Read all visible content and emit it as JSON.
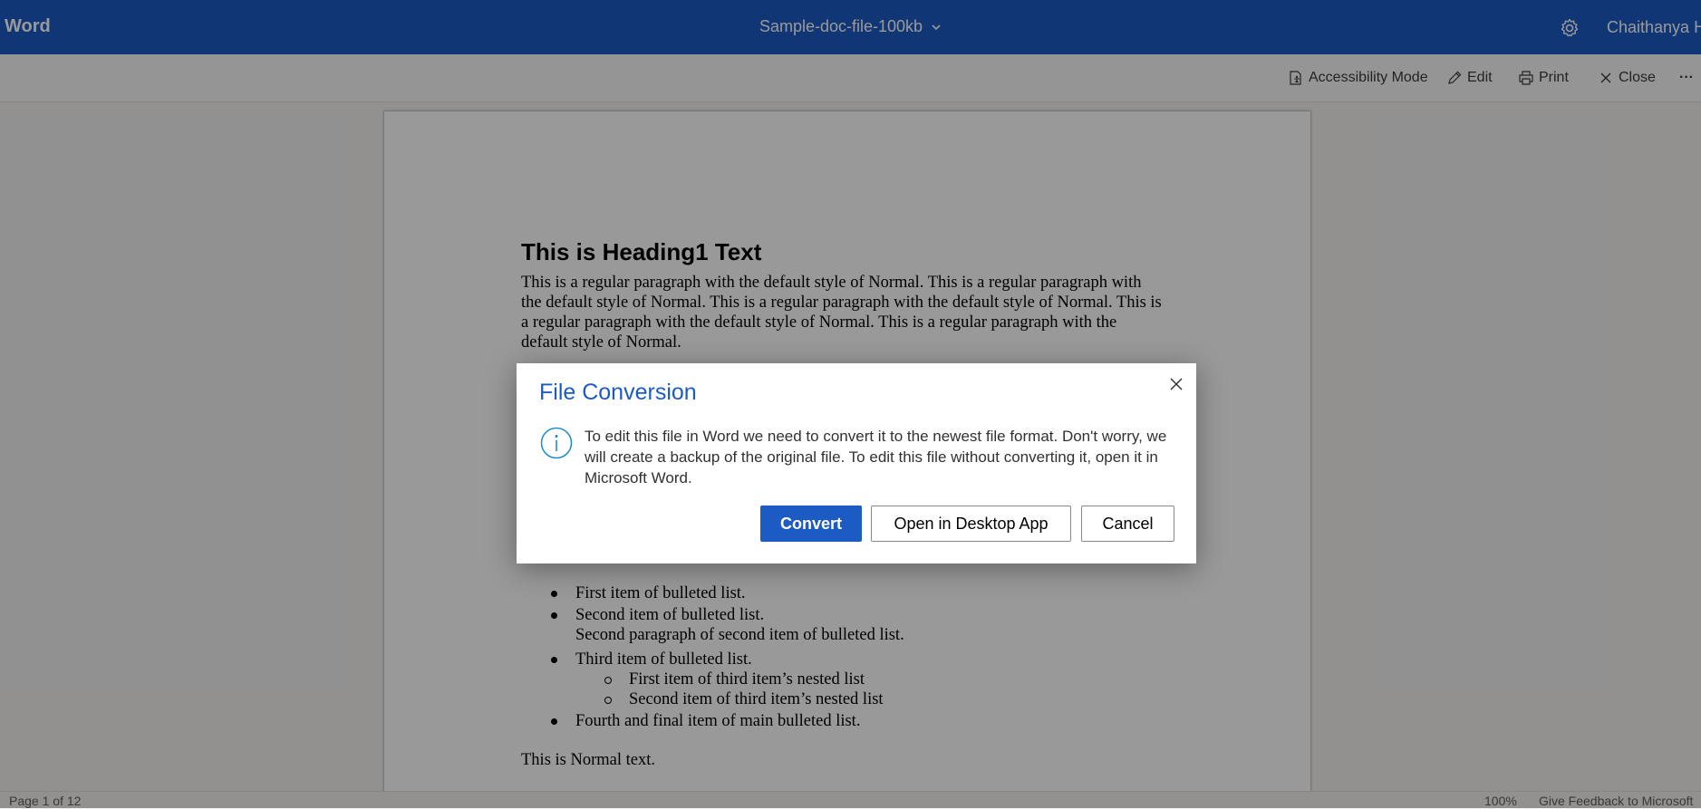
{
  "titlebar": {
    "app_name": "Word",
    "doc_title": "Sample-doc-file-100kb",
    "user_name": "Chaithanya H"
  },
  "toolbar": {
    "accessibility": "Accessibility Mode",
    "edit": "Edit",
    "print": "Print",
    "close": "Close",
    "more": "···"
  },
  "document": {
    "heading": "This is Heading1 Text",
    "paragraph": "This is a regular paragraph with the default style of Normal. This is a regular paragraph with the default style of Normal. This is a regular paragraph with the default style of Normal. This is a regular paragraph with the default style of Normal. This is a regular paragraph with the default style of Normal.",
    "bullets": {
      "item1": "First item of bulleted list.",
      "item2": "Second item of bulleted list.",
      "item2_para": "Second paragraph of second item of bulleted list.",
      "item3": "Third item of bulleted list.",
      "nested1": "First item of third item’s nested list",
      "nested2": "Second item of third item’s nested list",
      "item4": "Fourth and final item of main bulleted list."
    },
    "normal_text": "This is Normal text."
  },
  "status": {
    "page": "Page 1 of 12",
    "zoom": "100%",
    "feedback": "Give Feedback to Microsoft"
  },
  "dialog": {
    "title": "File Conversion",
    "message": "To edit this file in Word we need to convert it to the newest file format. Don't worry, we will create a backup of the original file. To edit this file without converting it, open it in Microsoft Word.",
    "convert": "Convert",
    "open_desktop": "Open in Desktop App",
    "cancel": "Cancel"
  },
  "colors": {
    "brand": "#1d5bc4",
    "overlay": "rgba(0,0,0,0.40)"
  }
}
